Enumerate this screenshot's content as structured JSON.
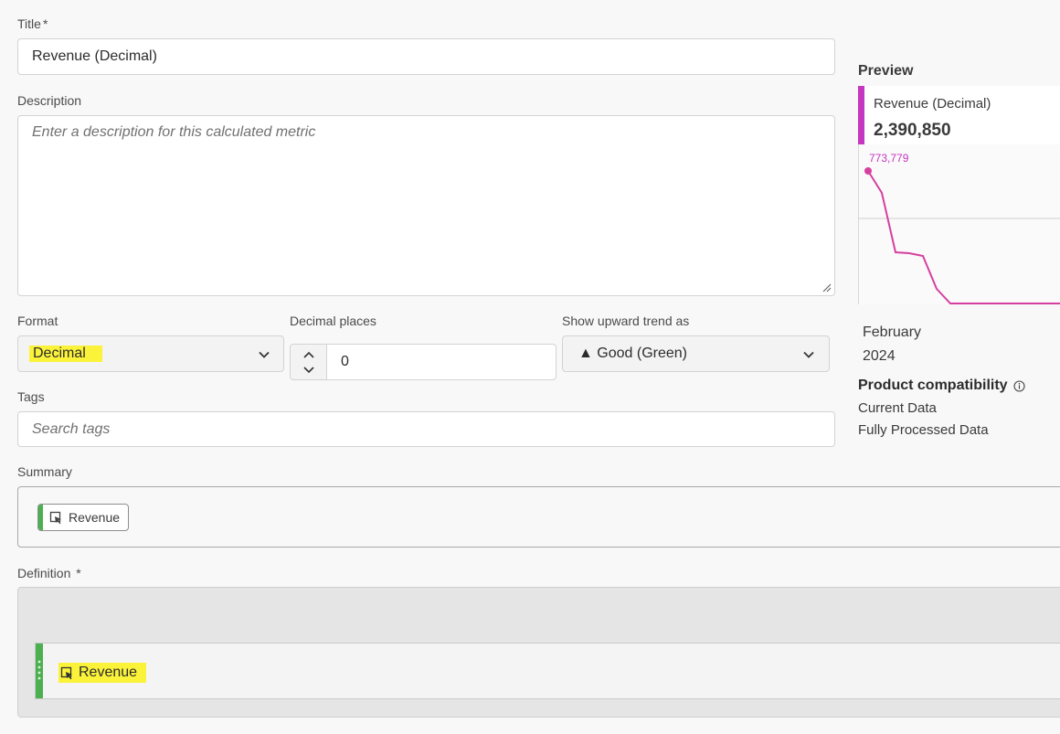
{
  "form": {
    "title_label": "Title",
    "title_required": "*",
    "title_value": "Revenue (Decimal)",
    "description_label": "Description",
    "description_placeholder": "Enter a description for this calculated metric",
    "format_label": "Format",
    "format_value": "Decimal",
    "decimal_places_label": "Decimal places",
    "decimal_places_value": "0",
    "trend_label": "Show upward trend as",
    "trend_value": "▲ Good (Green)",
    "tags_label": "Tags",
    "tags_placeholder": "Search tags",
    "summary_label": "Summary",
    "summary_chip": "Revenue",
    "definition_label": "Definition",
    "definition_required": "*",
    "definition_item": "Revenue"
  },
  "preview": {
    "heading": "Preview",
    "metric_name": "Revenue (Decimal)",
    "metric_total": "2,390,850",
    "peak_label": "773,779",
    "period_month": "February",
    "period_year": "2024",
    "compat_heading": "Product compatibility",
    "compat_items": [
      "Current Data",
      "Fully Processed Data"
    ]
  },
  "colors": {
    "accent_magenta": "#c536c1",
    "line_pink": "#d63fa0",
    "component_green": "#4caf50",
    "highlight_yellow": "#fbf33a"
  }
}
